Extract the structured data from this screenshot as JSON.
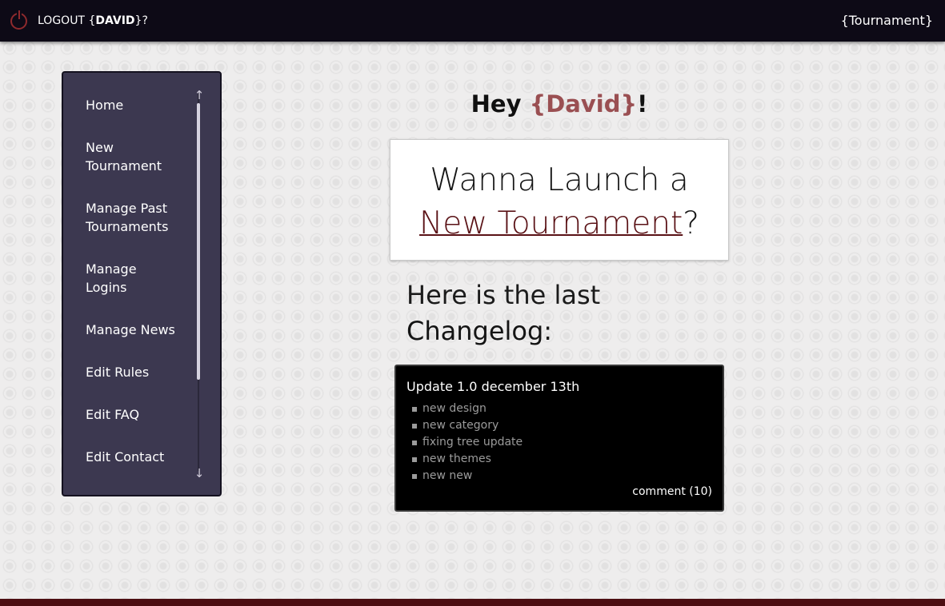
{
  "header": {
    "logout_prefix": "LOGOUT {",
    "user_name": "DAVID",
    "logout_suffix": "}?",
    "brand": "{Tournament}",
    "icons": {
      "power": "power-icon"
    },
    "colors": {
      "bar": "#0d0a16",
      "power": "#8e2a2d"
    }
  },
  "sidebar": {
    "items": [
      {
        "label": "Home"
      },
      {
        "label": "New\nTournament"
      },
      {
        "label": "Manage Past\nTournaments"
      },
      {
        "label": "Manage\nLogins"
      },
      {
        "label": "Manage News"
      },
      {
        "label": "Edit Rules"
      },
      {
        "label": "Edit FAQ"
      },
      {
        "label": "Edit Contact"
      }
    ],
    "icons": {
      "up": "arrow-up-icon",
      "down": "arrow-down-icon"
    },
    "colors": {
      "background": "#3c3850"
    }
  },
  "main": {
    "greeting_prefix": "Hey ",
    "greeting_name": "{David}",
    "greeting_suffix": "!",
    "launch_line1": "Wanna Launch a",
    "launch_link": "New Tournament",
    "launch_suffix": "?",
    "changelog_intro_light": "Here is the last",
    "changelog_intro_bold": "Changelog",
    "changelog_intro_colon": ":",
    "colors": {
      "accent": "#9a4f52",
      "link": "#5a1216"
    }
  },
  "changelog": {
    "title": "Update 1.0 december 13th",
    "items": [
      "new design",
      "new category",
      "fixing tree update",
      "new themes",
      "new new"
    ],
    "comment_label": "comment (10)"
  },
  "footer": {
    "colors": {
      "bar": "#4c0e12"
    }
  }
}
